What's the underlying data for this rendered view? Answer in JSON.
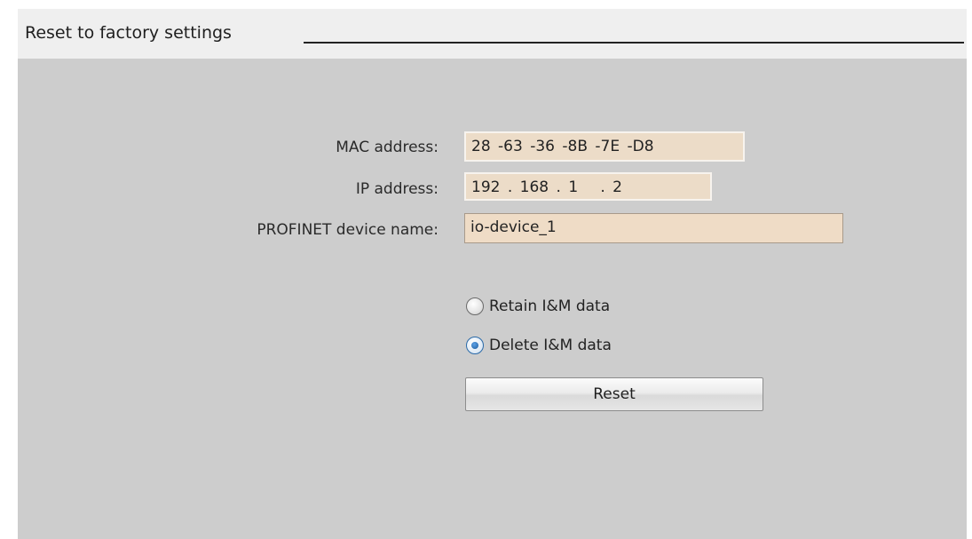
{
  "section": {
    "title": "Reset to factory settings"
  },
  "form": {
    "mac_label": "MAC address:",
    "mac_value": "28 -63 -36 -8B -7E -D8",
    "ip_label": "IP address:",
    "ip_value": "192 . 168 . 1   . 2",
    "device_name_label": "PROFINET device name:",
    "device_name_value": "io-device_1"
  },
  "options": {
    "retain_label": "Retain I&M data",
    "retain_checked": false,
    "delete_label": "Delete I&M data",
    "delete_checked": true
  },
  "actions": {
    "reset_label": "Reset"
  },
  "colors": {
    "panel_bg": "#cdcdcd",
    "field_bg": "#ecdcc8",
    "radio_accent": "#1f5e9e"
  }
}
